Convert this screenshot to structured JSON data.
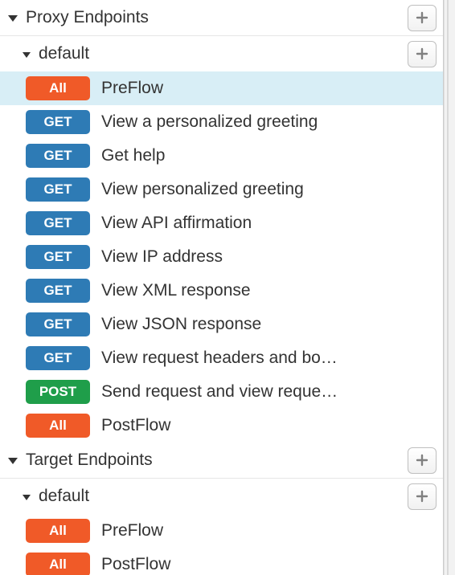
{
  "sections": [
    {
      "id": "proxy-endpoints",
      "title": "Proxy Endpoints",
      "groups": [
        {
          "id": "proxy-default",
          "title": "default",
          "flows": [
            {
              "method": "All",
              "color": "orange",
              "label": "PreFlow",
              "selected": true
            },
            {
              "method": "GET",
              "color": "blue",
              "label": "View a personalized greeting"
            },
            {
              "method": "GET",
              "color": "blue",
              "label": "Get help"
            },
            {
              "method": "GET",
              "color": "blue",
              "label": "View personalized greeting"
            },
            {
              "method": "GET",
              "color": "blue",
              "label": "View API affirmation"
            },
            {
              "method": "GET",
              "color": "blue",
              "label": "View IP address"
            },
            {
              "method": "GET",
              "color": "blue",
              "label": "View XML response"
            },
            {
              "method": "GET",
              "color": "blue",
              "label": "View JSON response"
            },
            {
              "method": "GET",
              "color": "blue",
              "label": "View request headers and bo…"
            },
            {
              "method": "POST",
              "color": "green",
              "label": "Send request and view reque…"
            },
            {
              "method": "All",
              "color": "orange",
              "label": "PostFlow"
            }
          ]
        }
      ]
    },
    {
      "id": "target-endpoints",
      "title": "Target Endpoints",
      "groups": [
        {
          "id": "target-default",
          "title": "default",
          "flows": [
            {
              "method": "All",
              "color": "orange",
              "label": "PreFlow"
            },
            {
              "method": "All",
              "color": "orange",
              "label": "PostFlow"
            }
          ]
        }
      ]
    }
  ]
}
